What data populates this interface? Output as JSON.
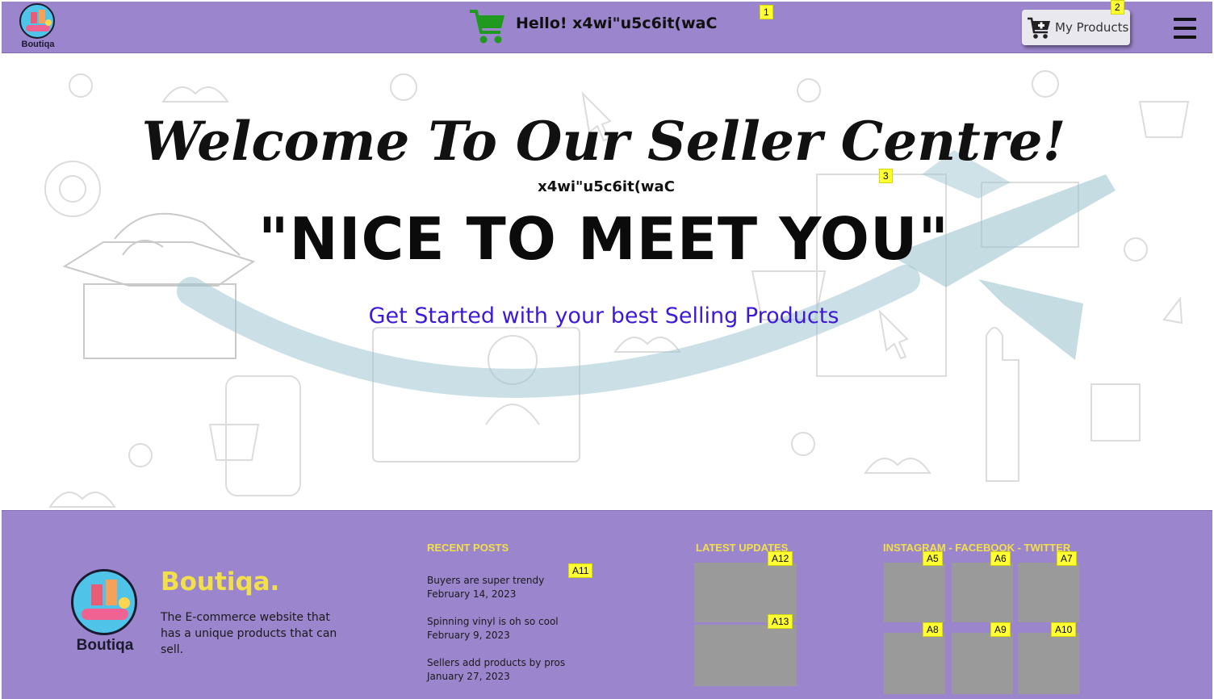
{
  "navbar": {
    "logo_text": "Boutiqa",
    "greeting": "Hello! x4wi\"u5c6it(waC",
    "my_products_label": "My Products",
    "colors": {
      "background": "#9b85cc",
      "cart": "#1f9a1f"
    }
  },
  "hero": {
    "title": "Welcome To Our Seller Centre!",
    "username": "x4wi\"u5c6it(waC",
    "tagline": "\"NICE TO MEET YOU\"",
    "subtitle": "Get Started with your best Selling Products",
    "subtitle_color": "#3d1ad6"
  },
  "footer": {
    "logo_text": "Boutiqa",
    "brand": "Boutiqa.",
    "brand_description": "The E-commerce website that has a unique products that can sell.",
    "recent_posts_title": "RECENT POSTS",
    "latest_updates_title": "LATEST UPDATES",
    "social_title": "INSTAGRAM - FACEBOOK - TWITTER",
    "posts": [
      {
        "title": "Buyers are super trendy",
        "date": "February 14, 2023"
      },
      {
        "title": "Spinning vinyl is oh so cool",
        "date": "February 9, 2023"
      },
      {
        "title": "Sellers add products by pros",
        "date": "January 27, 2023"
      }
    ],
    "brand_color": "#f2e04a"
  },
  "tags": {
    "t1": "1",
    "t2": "2",
    "t3": "3",
    "a5": "A5",
    "a6": "A6",
    "a7": "A7",
    "a8": "A8",
    "a9": "A9",
    "a10": "A10",
    "a11": "A11",
    "a12": "A12",
    "a13": "A13"
  }
}
